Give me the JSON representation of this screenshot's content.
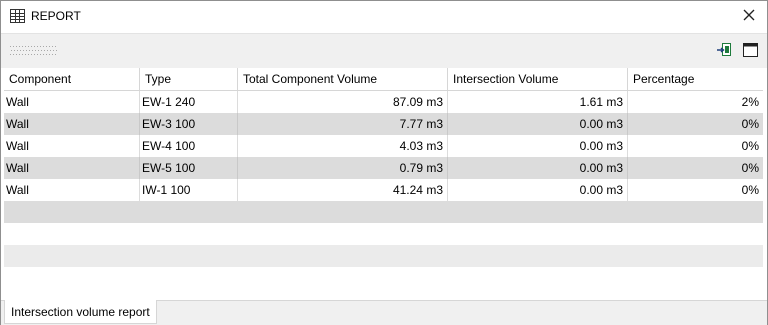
{
  "window": {
    "title": "REPORT",
    "title_icon": "table-icon",
    "close_icon": "close-icon"
  },
  "toolbar": {
    "grip_icon": "toolbar-grip-icon",
    "export_icon": "export-excel-icon",
    "window_icon": "window-layout-icon"
  },
  "table": {
    "columns": [
      "Component",
      "Type",
      "Total Component Volume",
      "Intersection Volume",
      "Percentage"
    ],
    "rows": [
      [
        "Wall",
        "EW-1 240",
        "87.09 m3",
        "1.61 m3",
        "2%"
      ],
      [
        "Wall",
        "EW-3 100",
        "7.77 m3",
        "0.00 m3",
        "0%"
      ],
      [
        "Wall",
        "EW-4 100",
        "4.03 m3",
        "0.00 m3",
        "0%"
      ],
      [
        "Wall",
        "EW-5 100",
        "0.79 m3",
        "0.00 m3",
        "0%"
      ],
      [
        "Wall",
        "IW-1 100",
        "41.24 m3",
        "0.00 m3",
        "0%"
      ]
    ]
  },
  "tabs": [
    {
      "label": "Intersection volume report"
    }
  ],
  "colors": {
    "alt_row": "#dcdcdc",
    "toolbar": "#f0f0f0",
    "export_green": "#1e7b3c"
  }
}
